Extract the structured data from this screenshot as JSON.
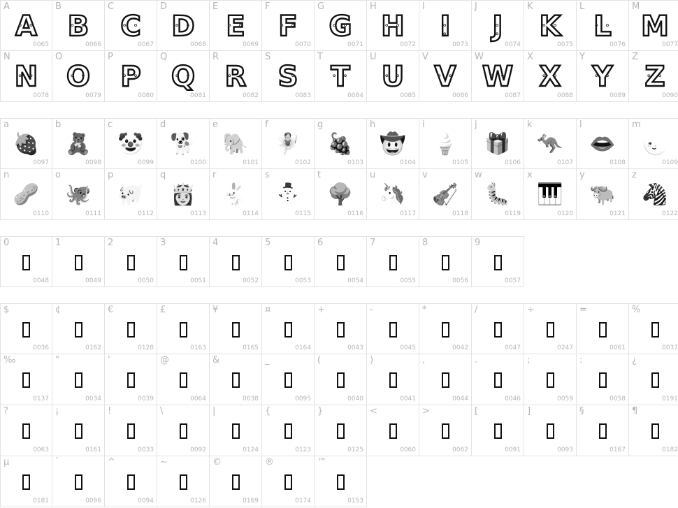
{
  "uppercase": [
    {
      "label": "A",
      "code": "0065"
    },
    {
      "label": "B",
      "code": "0066"
    },
    {
      "label": "C",
      "code": "0067"
    },
    {
      "label": "D",
      "code": "0068"
    },
    {
      "label": "E",
      "code": "0069"
    },
    {
      "label": "F",
      "code": "0070"
    },
    {
      "label": "G",
      "code": "0071"
    },
    {
      "label": "H",
      "code": "0072"
    },
    {
      "label": "I",
      "code": "0073"
    },
    {
      "label": "J",
      "code": "0074"
    },
    {
      "label": "K",
      "code": "0075"
    },
    {
      "label": "L",
      "code": "0076"
    },
    {
      "label": "M",
      "code": "0077"
    },
    {
      "label": "N",
      "code": "0078"
    },
    {
      "label": "O",
      "code": "0079"
    },
    {
      "label": "P",
      "code": "0080"
    },
    {
      "label": "Q",
      "code": "0081"
    },
    {
      "label": "R",
      "code": "0082"
    },
    {
      "label": "S",
      "code": "0083"
    },
    {
      "label": "T",
      "code": "0084"
    },
    {
      "label": "U",
      "code": "0085"
    },
    {
      "label": "V",
      "code": "0086"
    },
    {
      "label": "W",
      "code": "0087"
    },
    {
      "label": "X",
      "code": "0088"
    },
    {
      "label": "Y",
      "code": "0089"
    },
    {
      "label": "Z",
      "code": "0090"
    }
  ],
  "lowercase": [
    {
      "label": "a",
      "code": "0097",
      "icon": "strawberry-icon",
      "glyph": "🍓"
    },
    {
      "label": "b",
      "code": "0098",
      "icon": "teddy-bear-icon",
      "glyph": "🧸"
    },
    {
      "label": "c",
      "code": "0099",
      "icon": "clown-icon",
      "glyph": "🤡"
    },
    {
      "label": "d",
      "code": "0100",
      "icon": "dog-icon",
      "glyph": "🐕"
    },
    {
      "label": "e",
      "code": "0101",
      "icon": "elephant-icon",
      "glyph": "🐘"
    },
    {
      "label": "f",
      "code": "0102",
      "icon": "fairy-icon",
      "glyph": "🧚"
    },
    {
      "label": "g",
      "code": "0103",
      "icon": "grapes-icon",
      "glyph": "🍇"
    },
    {
      "label": "h",
      "code": "0104",
      "icon": "hat-icon",
      "glyph": "🤠"
    },
    {
      "label": "i",
      "code": "0105",
      "icon": "ice-cream-icon",
      "glyph": "🍦"
    },
    {
      "label": "j",
      "code": "0106",
      "icon": "jack-in-the-box-icon",
      "glyph": "🎁"
    },
    {
      "label": "k",
      "code": "0107",
      "icon": "kangaroo-icon",
      "glyph": "🦘"
    },
    {
      "label": "l",
      "code": "0108",
      "icon": "lips-icon",
      "glyph": "👄"
    },
    {
      "label": "m",
      "code": "0109",
      "icon": "moon-icon",
      "glyph": "🌜"
    },
    {
      "label": "n",
      "code": "0110",
      "icon": "nut-icon",
      "glyph": "🥜"
    },
    {
      "label": "o",
      "code": "0111",
      "icon": "octopus-icon",
      "glyph": "🐙"
    },
    {
      "label": "p",
      "code": "0112",
      "icon": "pig-icon",
      "glyph": "🐖"
    },
    {
      "label": "q",
      "code": "0113",
      "icon": "queen-icon",
      "glyph": "👸"
    },
    {
      "label": "r",
      "code": "0114",
      "icon": "rabbit-icon",
      "glyph": "🐇"
    },
    {
      "label": "s",
      "code": "0115",
      "icon": "snowman-icon",
      "glyph": "⛄"
    },
    {
      "label": "t",
      "code": "0116",
      "icon": "tree-icon",
      "glyph": "🌳"
    },
    {
      "label": "u",
      "code": "0117",
      "icon": "unicorn-icon",
      "glyph": "🦄"
    },
    {
      "label": "v",
      "code": "0118",
      "icon": "violin-icon",
      "glyph": "🎻"
    },
    {
      "label": "w",
      "code": "0119",
      "icon": "worm-icon",
      "glyph": "🐛"
    },
    {
      "label": "x",
      "code": "0120",
      "icon": "xylophone-icon",
      "glyph": "🎹"
    },
    {
      "label": "y",
      "code": "0121",
      "icon": "yak-icon",
      "glyph": "🐃"
    },
    {
      "label": "z",
      "code": "0122",
      "icon": "zebra-icon",
      "glyph": "🦓"
    }
  ],
  "digits": [
    {
      "label": "0",
      "code": "0048"
    },
    {
      "label": "1",
      "code": "0049"
    },
    {
      "label": "2",
      "code": "0050"
    },
    {
      "label": "3",
      "code": "0051"
    },
    {
      "label": "4",
      "code": "0052"
    },
    {
      "label": "5",
      "code": "0053"
    },
    {
      "label": "6",
      "code": "0054"
    },
    {
      "label": "7",
      "code": "0055"
    },
    {
      "label": "8",
      "code": "0056"
    },
    {
      "label": "9",
      "code": "0057"
    }
  ],
  "symbols": [
    {
      "label": "$",
      "code": "0036"
    },
    {
      "label": "¢",
      "code": "0162"
    },
    {
      "label": "€",
      "code": "0128"
    },
    {
      "label": "£",
      "code": "0163"
    },
    {
      "label": "¥",
      "code": "0165"
    },
    {
      "label": "¤",
      "code": "0164"
    },
    {
      "label": "+",
      "code": "0043"
    },
    {
      "label": "-",
      "code": "0045"
    },
    {
      "label": "*",
      "code": "0042"
    },
    {
      "label": "/",
      "code": "0047"
    },
    {
      "label": "÷",
      "code": "0247"
    },
    {
      "label": "=",
      "code": "0061"
    },
    {
      "label": "%",
      "code": "0037"
    },
    {
      "label": "‰",
      "code": "0137"
    },
    {
      "label": "\"",
      "code": "0034"
    },
    {
      "label": "'",
      "code": "0039"
    },
    {
      "label": "@",
      "code": "0064"
    },
    {
      "label": "&",
      "code": "0038"
    },
    {
      "label": "_",
      "code": "0095"
    },
    {
      "label": "(",
      "code": "0040"
    },
    {
      "label": ")",
      "code": "0041"
    },
    {
      "label": ",",
      "code": "0044"
    },
    {
      "label": ".",
      "code": "0046"
    },
    {
      "label": ";",
      "code": "0059"
    },
    {
      "label": ":",
      "code": "0058"
    },
    {
      "label": "¿",
      "code": "0191"
    },
    {
      "label": "?",
      "code": "0063"
    },
    {
      "label": "¡",
      "code": "0161"
    },
    {
      "label": "!",
      "code": "0033"
    },
    {
      "label": "\\",
      "code": "0092"
    },
    {
      "label": "|",
      "code": "0124"
    },
    {
      "label": "{",
      "code": "0123"
    },
    {
      "label": "}",
      "code": "0125"
    },
    {
      "label": "<",
      "code": "0060"
    },
    {
      "label": ">",
      "code": "0062"
    },
    {
      "label": "[",
      "code": "0091"
    },
    {
      "label": "]",
      "code": "0093"
    },
    {
      "label": "§",
      "code": "0167"
    },
    {
      "label": "¶",
      "code": "0182"
    },
    {
      "label": "µ",
      "code": "0181"
    },
    {
      "label": "`",
      "code": "0096"
    },
    {
      "label": "^",
      "code": "0094"
    },
    {
      "label": "~",
      "code": "0126"
    },
    {
      "label": "©",
      "code": "0169"
    },
    {
      "label": "®",
      "code": "0174"
    },
    {
      "label": "™",
      "code": "0153"
    }
  ]
}
